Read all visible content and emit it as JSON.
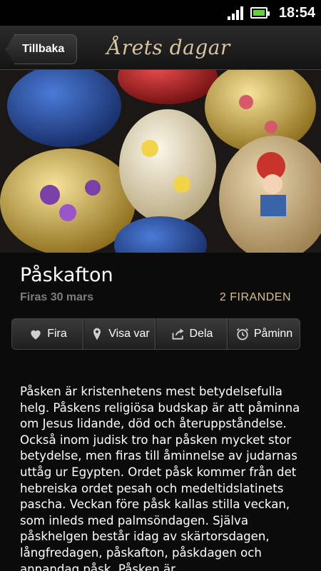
{
  "status": {
    "time": "18:54"
  },
  "header": {
    "back_label": "Tillbaka",
    "logo_text": "Årets dagar"
  },
  "event": {
    "title": "Påskafton",
    "date_text": "Firas 30 mars",
    "celebrators_text": "2 FIRANDEN",
    "description": "Påsken är kristenhetens mest betydelsefulla helg. Påskens religiösa budskap är att påminna om Jesus lidande, död och återuppståndelse. Också inom judisk tro har påsken mycket stor betydelse, men firas till åminnelse av judarnas uttåg ur Egypten. Ordet påsk kommer från det hebreiska ordet pesah och medeltidslatinets pascha. Veckan före påsk kallas stilla veckan, som inleds med palmsöndagen. Själva påskhelgen består idag av skärtorsdagen, långfredagen, påskafton, påskdagen och annandag påsk. Påsken är"
  },
  "actions": [
    {
      "label": "Fira",
      "icon": "heart-icon"
    },
    {
      "label": "Visa var",
      "icon": "location-pin-icon"
    },
    {
      "label": "Dela",
      "icon": "share-icon"
    },
    {
      "label": "Påminn",
      "icon": "alarm-clock-icon"
    }
  ],
  "colors": {
    "accent": "#d6c08d",
    "muted": "#7d7d7d",
    "battery": "#5fd33a"
  }
}
